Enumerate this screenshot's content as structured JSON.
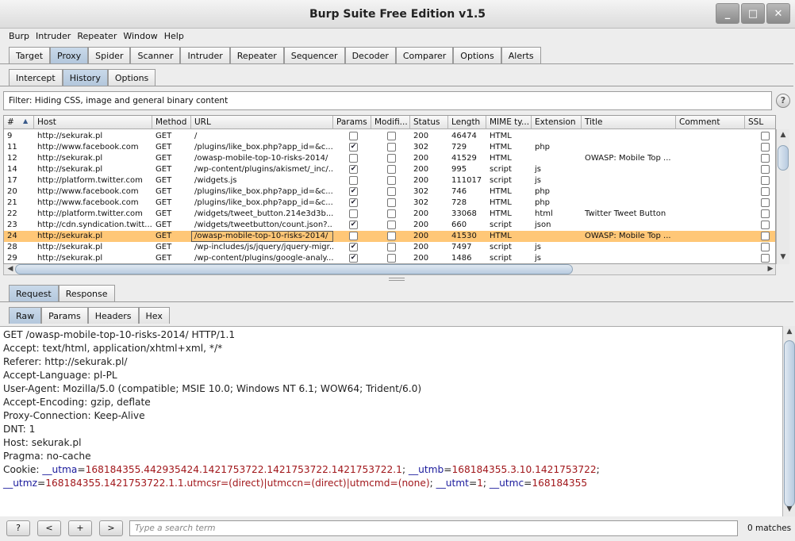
{
  "window": {
    "title": "Burp Suite Free Edition v1.5",
    "controls": [
      "_",
      "□",
      "✕"
    ]
  },
  "menu": [
    "Burp",
    "Intruder",
    "Repeater",
    "Window",
    "Help"
  ],
  "main_tabs": [
    "Target",
    "Proxy",
    "Spider",
    "Scanner",
    "Intruder",
    "Repeater",
    "Sequencer",
    "Decoder",
    "Comparer",
    "Options",
    "Alerts"
  ],
  "main_tab_active": "Proxy",
  "proxy_tabs": [
    "Intercept",
    "History",
    "Options"
  ],
  "proxy_tab_active": "History",
  "filter": {
    "text": "Filter:  Hiding CSS, image and general binary content",
    "help": "?"
  },
  "columns": [
    "#",
    "Host",
    "Method",
    "URL",
    "Params",
    "Modifi...",
    "Status",
    "Length",
    "MIME ty...",
    "Extension",
    "Title",
    "Comment",
    "SSL"
  ],
  "sort_indicator": "▲",
  "rows": [
    {
      "num": "9",
      "host": "http://sekurak.pl",
      "method": "GET",
      "url": "/",
      "params": false,
      "modified": false,
      "status": "200",
      "length": "46474",
      "mime": "HTML",
      "ext": "",
      "title": "",
      "comment": "",
      "ssl": false
    },
    {
      "num": "11",
      "host": "http://www.facebook.com",
      "method": "GET",
      "url": "/plugins/like_box.php?app_id=&c...",
      "params": true,
      "modified": false,
      "status": "302",
      "length": "729",
      "mime": "HTML",
      "ext": "php",
      "title": "",
      "comment": "",
      "ssl": false
    },
    {
      "num": "12",
      "host": "http://sekurak.pl",
      "method": "GET",
      "url": "/owasp-mobile-top-10-risks-2014/",
      "params": false,
      "modified": false,
      "status": "200",
      "length": "41529",
      "mime": "HTML",
      "ext": "",
      "title": "OWASP: Mobile Top ...",
      "comment": "",
      "ssl": false
    },
    {
      "num": "14",
      "host": "http://sekurak.pl",
      "method": "GET",
      "url": "/wp-content/plugins/akismet/_inc/...",
      "params": true,
      "modified": false,
      "status": "200",
      "length": "995",
      "mime": "script",
      "ext": "js",
      "title": "",
      "comment": "",
      "ssl": false
    },
    {
      "num": "17",
      "host": "http://platform.twitter.com",
      "method": "GET",
      "url": "/widgets.js",
      "params": false,
      "modified": false,
      "status": "200",
      "length": "111017",
      "mime": "script",
      "ext": "js",
      "title": "",
      "comment": "",
      "ssl": false
    },
    {
      "num": "20",
      "host": "http://www.facebook.com",
      "method": "GET",
      "url": "/plugins/like_box.php?app_id=&c...",
      "params": true,
      "modified": false,
      "status": "302",
      "length": "746",
      "mime": "HTML",
      "ext": "php",
      "title": "",
      "comment": "",
      "ssl": false
    },
    {
      "num": "21",
      "host": "http://www.facebook.com",
      "method": "GET",
      "url": "/plugins/like_box.php?app_id=&c...",
      "params": true,
      "modified": false,
      "status": "302",
      "length": "728",
      "mime": "HTML",
      "ext": "php",
      "title": "",
      "comment": "",
      "ssl": false
    },
    {
      "num": "22",
      "host": "http://platform.twitter.com",
      "method": "GET",
      "url": "/widgets/tweet_button.214e3d3b...",
      "params": false,
      "modified": false,
      "status": "200",
      "length": "33068",
      "mime": "HTML",
      "ext": "html",
      "title": "Twitter Tweet Button",
      "comment": "",
      "ssl": false
    },
    {
      "num": "23",
      "host": "http://cdn.syndication.twitt...",
      "method": "GET",
      "url": "/widgets/tweetbutton/count.json?...",
      "params": true,
      "modified": false,
      "status": "200",
      "length": "660",
      "mime": "script",
      "ext": "json",
      "title": "",
      "comment": "",
      "ssl": false
    },
    {
      "num": "24",
      "host": "http://sekurak.pl",
      "method": "GET",
      "url": "/owasp-mobile-top-10-risks-2014/",
      "params": false,
      "modified": false,
      "status": "200",
      "length": "41530",
      "mime": "HTML",
      "ext": "",
      "title": "OWASP: Mobile Top ...",
      "comment": "",
      "ssl": false,
      "selected": true
    },
    {
      "num": "28",
      "host": "http://sekurak.pl",
      "method": "GET",
      "url": "/wp-includes/js/jquery/jquery-migr...",
      "params": true,
      "modified": false,
      "status": "200",
      "length": "7497",
      "mime": "script",
      "ext": "js",
      "title": "",
      "comment": "",
      "ssl": false
    },
    {
      "num": "29",
      "host": "http://sekurak.pl",
      "method": "GET",
      "url": "/wp-content/plugins/google-analy...",
      "params": true,
      "modified": false,
      "status": "200",
      "length": "1486",
      "mime": "script",
      "ext": "js",
      "title": "",
      "comment": "",
      "ssl": false
    }
  ],
  "message_tabs": [
    "Request",
    "Response"
  ],
  "message_tab_active": "Request",
  "view_tabs": [
    "Raw",
    "Params",
    "Headers",
    "Hex"
  ],
  "view_tab_active": "Raw",
  "request_lines": [
    "GET /owasp-mobile-top-10-risks-2014/ HTTP/1.1",
    "Accept: text/html, application/xhtml+xml, */*",
    "Referer: http://sekurak.pl/",
    "Accept-Language: pl-PL",
    "User-Agent: Mozilla/5.0 (compatible; MSIE 10.0; Windows NT 6.1; WOW64; Trident/6.0)",
    "Accept-Encoding: gzip, deflate",
    "Proxy-Connection: Keep-Alive",
    "DNT: 1",
    "Host: sekurak.pl",
    "Pragma: no-cache"
  ],
  "cookie_lines": [
    [
      [
        "plain",
        "Cookie: "
      ],
      [
        "name",
        "__utma"
      ],
      [
        "plain",
        "="
      ],
      [
        "val",
        "168184355.442935424.1421753722.1421753722.1421753722.1"
      ],
      [
        "plain",
        "; "
      ],
      [
        "name",
        "__utmb"
      ],
      [
        "plain",
        "="
      ],
      [
        "val",
        "168184355.3.10.1421753722"
      ],
      [
        "plain",
        ";"
      ]
    ],
    [
      [
        "name",
        "__utmz"
      ],
      [
        "plain",
        "="
      ],
      [
        "val",
        "168184355.1421753722.1.1.utmcsr=(direct)|utmccn=(direct)|utmcmd=(none)"
      ],
      [
        "plain",
        "; "
      ],
      [
        "name",
        "__utmt"
      ],
      [
        "plain",
        "="
      ],
      [
        "val",
        "1"
      ],
      [
        "plain",
        "; "
      ],
      [
        "name",
        "__utmc"
      ],
      [
        "plain",
        "="
      ],
      [
        "val",
        "168184355"
      ]
    ]
  ],
  "bottom": {
    "help": "?",
    "prev": "<",
    "add": "+",
    "next": ">",
    "search_placeholder": "Type a search term",
    "matches": "0 matches"
  }
}
